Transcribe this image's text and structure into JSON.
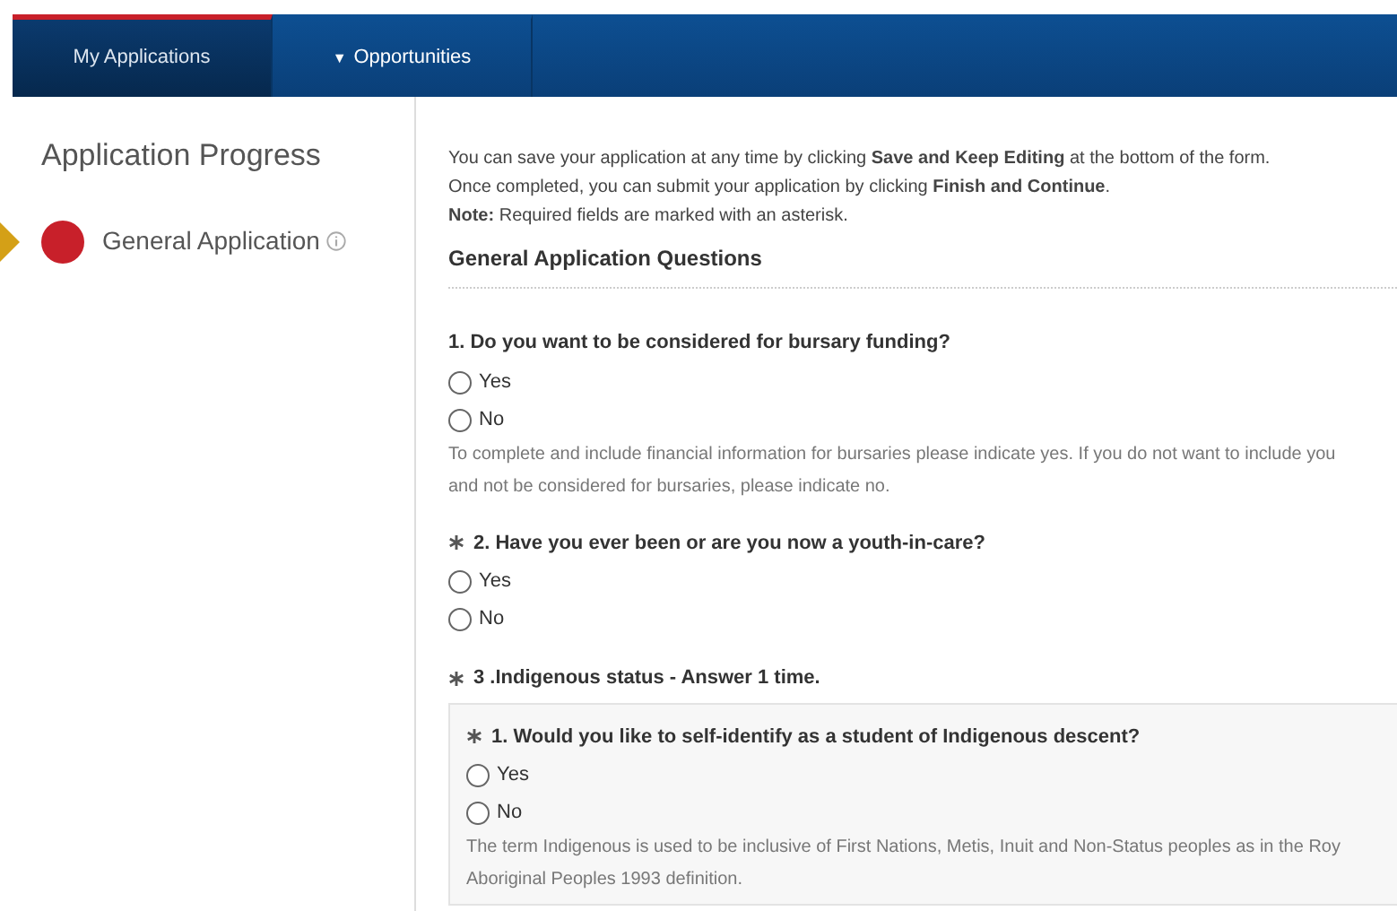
{
  "nav": {
    "tabs": [
      {
        "label": "My Applications",
        "selected": true,
        "dropdown": false
      },
      {
        "label": "Opportunities",
        "selected": false,
        "dropdown": true,
        "caret": "▼"
      }
    ]
  },
  "sidebar": {
    "title": "Application Progress",
    "steps": [
      {
        "label": "General Application",
        "current": true,
        "color": "#c8202a"
      }
    ]
  },
  "intro": [
    "You can save your application at any time by clicking **Save and Keep Editing** at the bottom of the form.",
    "Once completed, you can submit your application by clicking **Finish and Continue**.",
    "**Note:** Required fields are marked with an asterisk."
  ],
  "section_title": "General Application Questions",
  "questions": [
    {
      "kind": "question",
      "required": false,
      "text": "1. Do you want to be considered for bursary funding?",
      "options": [
        {
          "label": "Yes",
          "selected": false
        },
        {
          "label": "No",
          "selected": false
        }
      ],
      "help": [
        "To complete and include financial information for bursaries please indicate yes. If you do not want to include you",
        "and not be considered for bursaries, please indicate no."
      ]
    },
    {
      "kind": "question",
      "required": true,
      "text": "2. Have you ever been or are you now a youth-in-care?",
      "options": [
        {
          "label": "Yes",
          "selected": false
        },
        {
          "label": "No",
          "selected": false
        }
      ]
    },
    {
      "kind": "group",
      "required": true,
      "text": "3 .Indigenous status - Answer 1 time.",
      "children": [
        {
          "kind": "question",
          "required": true,
          "text": "1. Would you like to self-identify as a student of Indigenous descent?",
          "options": [
            {
              "label": "Yes",
              "selected": false
            },
            {
              "label": "No",
              "selected": false
            }
          ],
          "help": [
            "The term Indigenous is used to be inclusive of First Nations, Metis, Inuit and Non-Status peoples as in the Roy",
            "Aboriginal Peoples 1993 definition."
          ]
        }
      ]
    }
  ]
}
